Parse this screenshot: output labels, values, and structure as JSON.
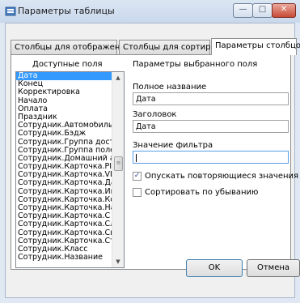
{
  "window": {
    "title": "Параметры таблицы",
    "controls": {
      "minimize": "—",
      "maximize": "□",
      "close": "✕"
    }
  },
  "tabs": [
    {
      "label": "Столбцы для отображения",
      "active": false
    },
    {
      "label": "Столбцы для сортировки",
      "active": false
    },
    {
      "label": "Параметры столбцов",
      "active": true
    }
  ],
  "available": {
    "label": "Доступные поля",
    "items": [
      "Дата",
      "Конец",
      "Корректировка",
      "Начало",
      "Оплата",
      "Праздник",
      "Сотрудник.Автомобиль N",
      "Сотрудник.Бэдж",
      "Сотрудник.Группа достуг",
      "Сотрудник.Группа полей",
      "Сотрудник.Домашний ад",
      "Сотрудник.Карточка.PIN",
      "Сотрудник.Карточка.VIP",
      "Сотрудник.Карточка.Дат",
      "Сотрудник.Карточка.Имя",
      "Сотрудник.Карточка.Код",
      "Сотрудник.Карточка.Наз",
      "Сотрудник.Карточка.С ог",
      "Сотрудник.Карточка.Слух",
      "Сотрудник.Карточка.Снят",
      "Сотрудник.Карточка.Стат",
      "Сотрудник.Класс",
      "Сотрудник.Название"
    ],
    "selected_index": 0
  },
  "params": {
    "header": "Параметры выбранного поля",
    "full_name_label": "Полное название",
    "full_name_value": "Дата",
    "caption_label": "Заголовок",
    "caption_value": "Дата",
    "filter_label": "Значение фильтра",
    "filter_value": "",
    "skip_repeated_label": "Опускать повторяющиеся значения",
    "skip_repeated_checked": true,
    "sort_desc_label": "Сортировать по убыванию",
    "sort_desc_checked": false
  },
  "buttons": {
    "ok": "OK",
    "cancel": "Отмена"
  }
}
